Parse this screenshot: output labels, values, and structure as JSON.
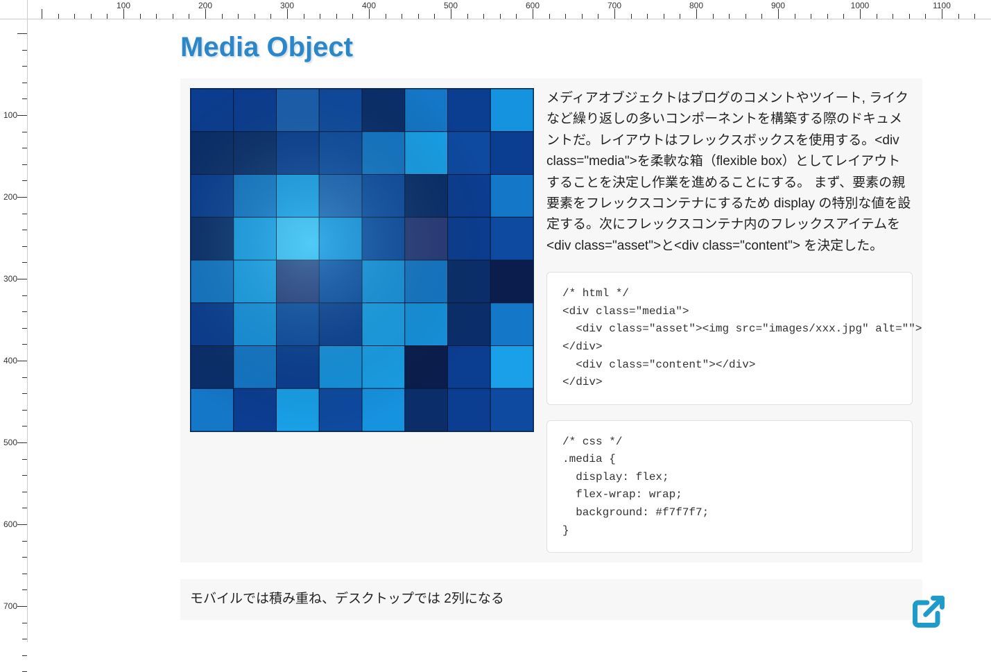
{
  "ruler": {
    "h_labels": [
      "100",
      "200",
      "300",
      "400",
      "500",
      "600",
      "700",
      "800",
      "900",
      "1000",
      "1100"
    ],
    "v_labels": [
      "100",
      "200",
      "300",
      "400",
      "500",
      "600",
      "700"
    ]
  },
  "title": "Media Object",
  "paragraph1": "メディアオブジェクトはブログのコメントやツイート, ライクなど繰り返しの多いコンポーネントを構築する際のドキュメントだ。レイアウトはフレックスボックスを使用する。<div class=\"media\">を柔軟な箱（flexible box）としてレイアウトすることを決定し作業を進めることにする。 まず、要素の親要素をフレックスコンテナにするため display の特別な値を設定する。次にフレックスコンテナ内のフレックスアイテムを<div class=\"asset\">と<div class=\"content\"> を決定した。",
  "code1": "/* html */\n<div class=\"media\">\n  <div class=\"asset\"><img src=\"images/xxx.jpg\" alt=\"\">\n</div>\n  <div class=\"content\"></div>\n</div>",
  "code2": "/* css */\n.media {\n  display: flex;\n  flex-wrap: wrap;\n  background: #f7f7f7;\n}",
  "paragraph2": "モバイルでは積み重ね、デスクトップでは 2列になる",
  "image": {
    "cols": 8,
    "rows": 8,
    "cell": 62,
    "colors": [
      [
        "#0b3d91",
        "#0b3d91",
        "#1b5fb0",
        "#0e4aa0",
        "#0b2e6b",
        "#1477c7",
        "#0b3d91",
        "#1693df"
      ],
      [
        "#0b2e6b",
        "#0b2e6b",
        "#0b3d91",
        "#0e4aa0",
        "#1477c7",
        "#19a0e8",
        "#0e4aa0",
        "#0b3d91"
      ],
      [
        "#0b3d91",
        "#1477c7",
        "#19a0e8",
        "#1b5fb0",
        "#0e4aa0",
        "#0b2e6b",
        "#0b3d91",
        "#1477c7"
      ],
      [
        "#0b2e6b",
        "#19a0e8",
        "#3cc1f5",
        "#1693df",
        "#0e4aa0",
        "#2b3a78",
        "#0b3d91",
        "#0e4aa0"
      ],
      [
        "#1477c7",
        "#19a0e8",
        "#2b3a78",
        "#0e4aa0",
        "#1693df",
        "#1477c7",
        "#0b2e6b",
        "#0b1d4d"
      ],
      [
        "#0b3d91",
        "#1693df",
        "#0e4aa0",
        "#0b3d91",
        "#19a0e8",
        "#1693df",
        "#0b2e6b",
        "#1477c7"
      ],
      [
        "#0b2e6b",
        "#1477c7",
        "#0b3d91",
        "#1693df",
        "#19a0e8",
        "#0b1d4d",
        "#0b3d91",
        "#19a0e8"
      ],
      [
        "#1477c7",
        "#0b3d91",
        "#19a0e8",
        "#0e4aa0",
        "#1693df",
        "#0b2e6b",
        "#0b3d91",
        "#0e4aa0"
      ]
    ]
  }
}
